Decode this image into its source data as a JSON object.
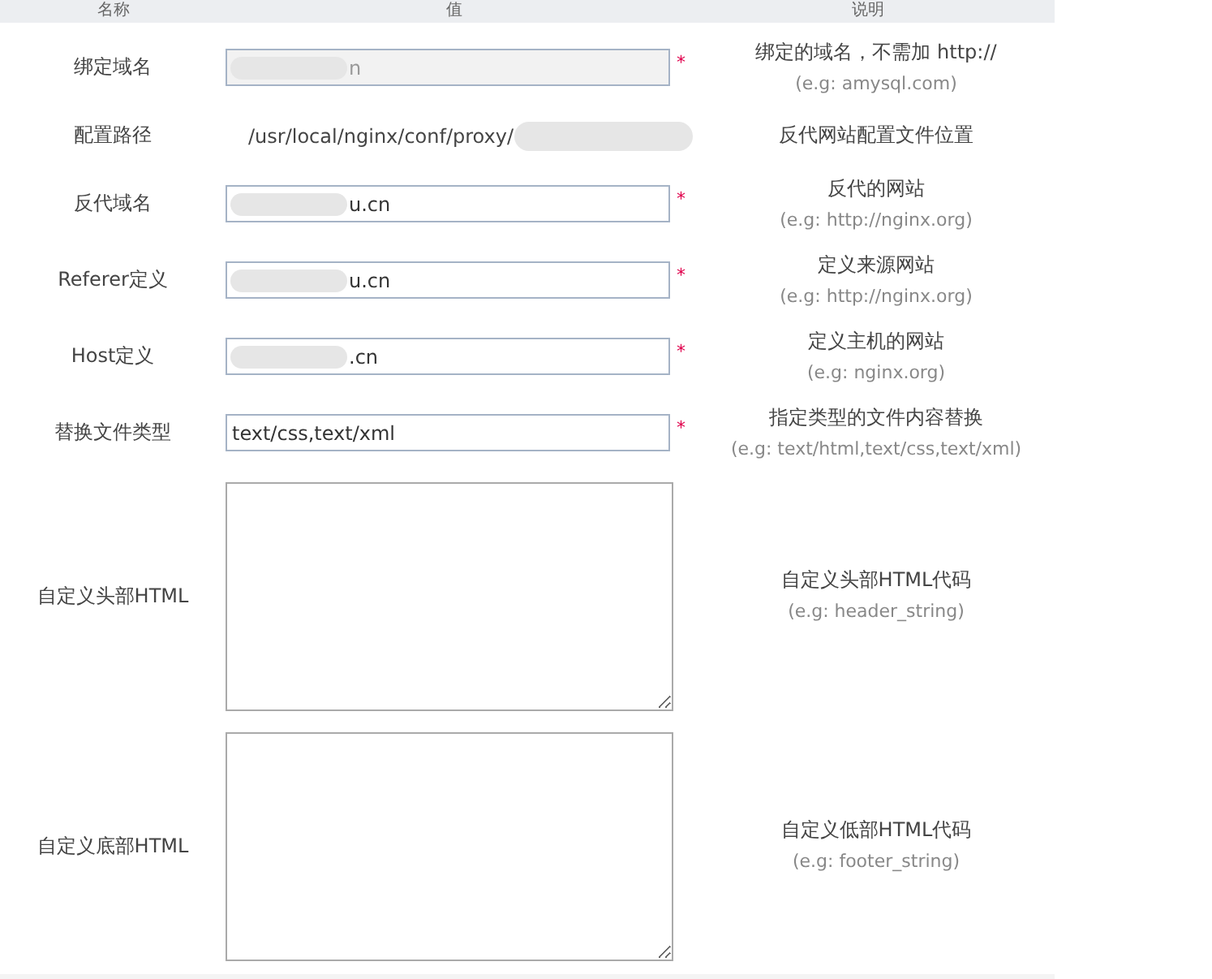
{
  "header": {
    "columns": [
      "名称",
      "值",
      "说明"
    ]
  },
  "rows": [
    {
      "kind": "input",
      "label": "绑定域名",
      "value": "n",
      "redacted": true,
      "disabled": true,
      "required": true,
      "required_mark": "*",
      "desc": "绑定的域名，不需加 http://",
      "example": "(e.g: amysql.com)"
    },
    {
      "kind": "text",
      "label": "配置路径",
      "value": "/usr/local/nginx/conf/proxy/",
      "redacted": true,
      "desc": "反代网站配置文件位置"
    },
    {
      "kind": "input",
      "label": "反代域名",
      "value": "u.cn",
      "redacted": true,
      "disabled": false,
      "required": true,
      "required_mark": "*",
      "desc": "反代的网站",
      "example": "(e.g: http://nginx.org)"
    },
    {
      "kind": "input",
      "label": "Referer定义",
      "value": "u.cn",
      "redacted": true,
      "disabled": false,
      "required": true,
      "required_mark": "*",
      "desc": "定义来源网站",
      "example": "(e.g: http://nginx.org)"
    },
    {
      "kind": "input",
      "label": "Host定义",
      "value": ".cn",
      "redacted": true,
      "disabled": false,
      "required": true,
      "required_mark": "*",
      "desc": "定义主机的网站",
      "example": "(e.g: nginx.org)"
    },
    {
      "kind": "input",
      "label": "替换文件类型",
      "value": "text/css,text/xml",
      "disabled": false,
      "required": true,
      "required_mark": "*",
      "desc": "指定类型的文件内容替换",
      "example": "(e.g: text/html,text/css,text/xml)"
    },
    {
      "kind": "textarea",
      "label": "自定义头部HTML",
      "desc": "自定义头部HTML代码",
      "example": "(e.g: header_string)"
    },
    {
      "kind": "textarea",
      "label": "自定义底部HTML",
      "desc": "自定义低部HTML代码",
      "example": "(e.g: footer_string)"
    }
  ]
}
